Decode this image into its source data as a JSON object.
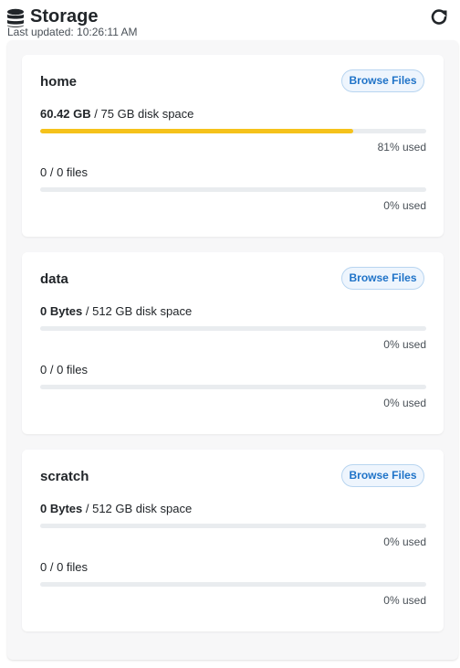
{
  "header": {
    "title": "Storage",
    "last_updated": "Last updated: 10:26:11 AM",
    "db_icon": "database-icon",
    "refresh_icon": "refresh-icon"
  },
  "colors": {
    "usage_fill": "#f5c21b",
    "button_text": "#1f73c8",
    "button_border": "#b8d5f0"
  },
  "volumes": [
    {
      "name": "home",
      "browse_label": "Browse Files",
      "used": "60.42 GB",
      "capacity": "/ 75 GB disk space",
      "disk_fraction": 0.81,
      "disk_pct_label": "81% used",
      "files_label": "0 / 0 files",
      "files_fraction": 0,
      "files_pct_label": "0% used"
    },
    {
      "name": "data",
      "browse_label": "Browse Files",
      "used": "0 Bytes",
      "capacity": "/ 512 GB disk space",
      "disk_fraction": 0,
      "disk_pct_label": "0% used",
      "files_label": "0 / 0 files",
      "files_fraction": 0,
      "files_pct_label": "0% used"
    },
    {
      "name": "scratch",
      "browse_label": "Browse Files",
      "used": "0 Bytes",
      "capacity": "/ 512 GB disk space",
      "disk_fraction": 0,
      "disk_pct_label": "0% used",
      "files_label": "0 / 0 files",
      "files_fraction": 0,
      "files_pct_label": "0% used"
    }
  ]
}
